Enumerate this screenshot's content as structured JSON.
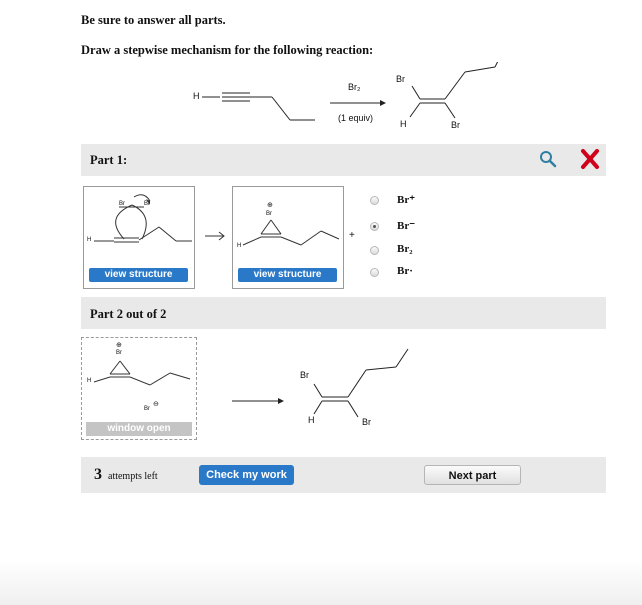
{
  "header": {
    "instruction1": "Be sure to answer all parts.",
    "instruction2": "Draw a stepwise mechanism for the following reaction:"
  },
  "reaction": {
    "reactant_h": "H",
    "reagent": "Br₂",
    "conditions": "(1 equiv)",
    "product_br_top": "Br",
    "product_h": "H",
    "product_br_bottom": "Br"
  },
  "part1": {
    "title": "Part 1:",
    "box1_atom_br_left": "Br",
    "box1_atom_br_right": "Br",
    "box1_atom_h": "H",
    "box1_button": "view structure",
    "box2_charge": "⊕",
    "box2_atom_br": "Br",
    "box2_atom_h": "H",
    "box2_button": "view structure",
    "plus": "+",
    "options": [
      {
        "label": "Br⁺",
        "selected": false
      },
      {
        "label": "Br⁻",
        "selected": true
      },
      {
        "label": "Br₂",
        "selected": false
      },
      {
        "label": "Br·",
        "selected": false
      }
    ]
  },
  "part2": {
    "title": "Part 2 out of 2",
    "box_charge": "⊕",
    "box_atom_br": "Br",
    "box_atom_h": "H",
    "box_bromide": "Br",
    "box_bromide_charge": "⊖",
    "window_button": "window open",
    "product_br_top": "Br",
    "product_h": "H",
    "product_br_bottom": "Br"
  },
  "footer": {
    "attempts_number": "3",
    "attempts_text": "attempts left",
    "check_button": "Check my work",
    "next_button": "Next part"
  },
  "colors": {
    "accent_blue": "#2a79c9",
    "error_red": "#d0021b",
    "search_teal": "#2f7fa3"
  }
}
